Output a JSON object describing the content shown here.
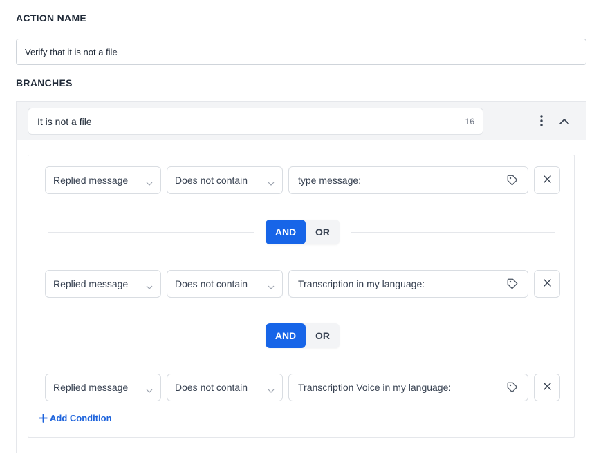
{
  "action": {
    "label": "ACTION NAME",
    "value": "Verify that it is not a file"
  },
  "branches": {
    "label": "BRANCHES",
    "branch": {
      "name": "It is not a file",
      "char_count": "16",
      "menu_icon": "kebab-menu-icon",
      "collapse_icon": "chevron-up-icon"
    },
    "conditions": [
      {
        "field": "Replied message",
        "operator": "Does not contain",
        "value": "type message:"
      },
      {
        "field": "Replied message",
        "operator": "Does not contain",
        "value": "Transcription in my language:"
      },
      {
        "field": "Replied message",
        "operator": "Does not contain",
        "value": "Transcription Voice in my language:"
      }
    ],
    "connectors": [
      {
        "and_label": "AND",
        "or_label": "OR",
        "selected": "AND"
      },
      {
        "and_label": "AND",
        "or_label": "OR",
        "selected": "AND"
      }
    ],
    "add_condition_label": "Add Condition"
  },
  "colors": {
    "accent": "#1765e8",
    "link": "#1d63dc",
    "header_bg": "#f3f4f6"
  }
}
